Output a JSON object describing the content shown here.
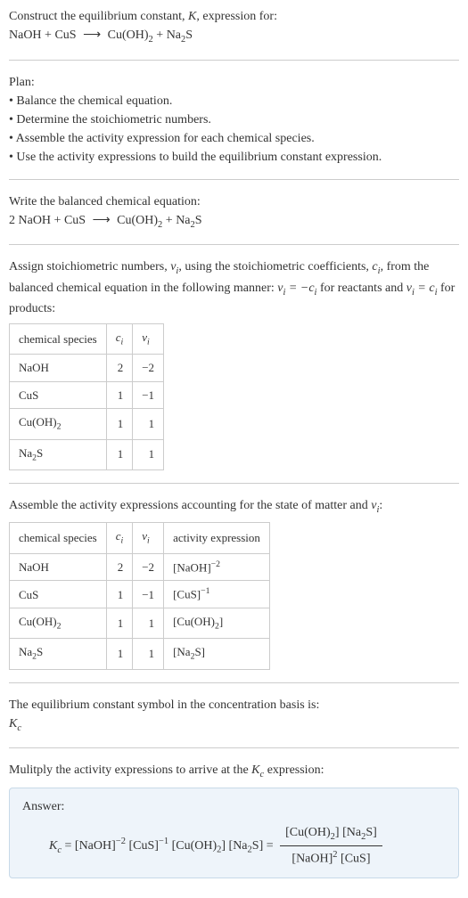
{
  "intro": {
    "line1_a": "Construct the equilibrium constant, ",
    "line1_b": ", expression for:"
  },
  "plan": {
    "heading": "Plan:",
    "b1": "• Balance the chemical equation.",
    "b2": "• Determine the stoichiometric numbers.",
    "b3": "• Assemble the activity expression for each chemical species.",
    "b4": "• Use the activity expressions to build the equilibrium constant expression."
  },
  "balanced_heading": "Write the balanced chemical equation:",
  "assign_text_a": "Assign stoichiometric numbers, ",
  "assign_text_b": ", using the stoichiometric coefficients, ",
  "assign_text_c": ", from the balanced chemical equation in the following manner: ",
  "assign_text_d": " for reactants and ",
  "assign_text_e": " for products:",
  "table1": {
    "h1": "chemical species",
    "rows": [
      {
        "species": "NaOH",
        "ci": "2",
        "vi": "−2"
      },
      {
        "species": "CuS",
        "ci": "1",
        "vi": "−1"
      },
      {
        "species": "Cu(OH)",
        "ci": "1",
        "vi": "1"
      },
      {
        "species": "Na",
        "species_suffix": "S",
        "ci": "1",
        "vi": "1"
      }
    ]
  },
  "assemble_text_a": "Assemble the activity expressions accounting for the state of matter and ",
  "assemble_text_b": ":",
  "table2": {
    "h1": "chemical species",
    "h4": "activity expression",
    "rows": [
      {
        "ci": "2",
        "vi": "−2"
      },
      {
        "ci": "1",
        "vi": "−1"
      },
      {
        "ci": "1",
        "vi": "1"
      },
      {
        "ci": "1",
        "vi": "1"
      }
    ]
  },
  "conc_basis_text": "The equilibrium constant symbol in the concentration basis is:",
  "multiply_text_a": "Mulitply the activity expressions to arrive at the ",
  "multiply_text_b": " expression:",
  "answer_label": "Answer:",
  "chart_data": {
    "type": "table",
    "reaction_unbalanced": "NaOH + CuS ⟶ Cu(OH)2 + Na2S",
    "reaction_balanced": "2 NaOH + CuS ⟶ Cu(OH)2 + Na2S",
    "stoichiometric_table": [
      {
        "species": "NaOH",
        "c_i": 2,
        "v_i": -2
      },
      {
        "species": "CuS",
        "c_i": 1,
        "v_i": -1
      },
      {
        "species": "Cu(OH)2",
        "c_i": 1,
        "v_i": 1
      },
      {
        "species": "Na2S",
        "c_i": 1,
        "v_i": 1
      }
    ],
    "activity_table": [
      {
        "species": "NaOH",
        "c_i": 2,
        "v_i": -2,
        "activity": "[NaOH]^-2"
      },
      {
        "species": "CuS",
        "c_i": 1,
        "v_i": -1,
        "activity": "[CuS]^-1"
      },
      {
        "species": "Cu(OH)2",
        "c_i": 1,
        "v_i": 1,
        "activity": "[Cu(OH)2]"
      },
      {
        "species": "Na2S",
        "c_i": 1,
        "v_i": 1,
        "activity": "[Na2S]"
      }
    ],
    "equilibrium_constant": "K_c = [NaOH]^-2 [CuS]^-1 [Cu(OH)2] [Na2S] = ([Cu(OH)2] [Na2S]) / ([NaOH]^2 [CuS])"
  }
}
